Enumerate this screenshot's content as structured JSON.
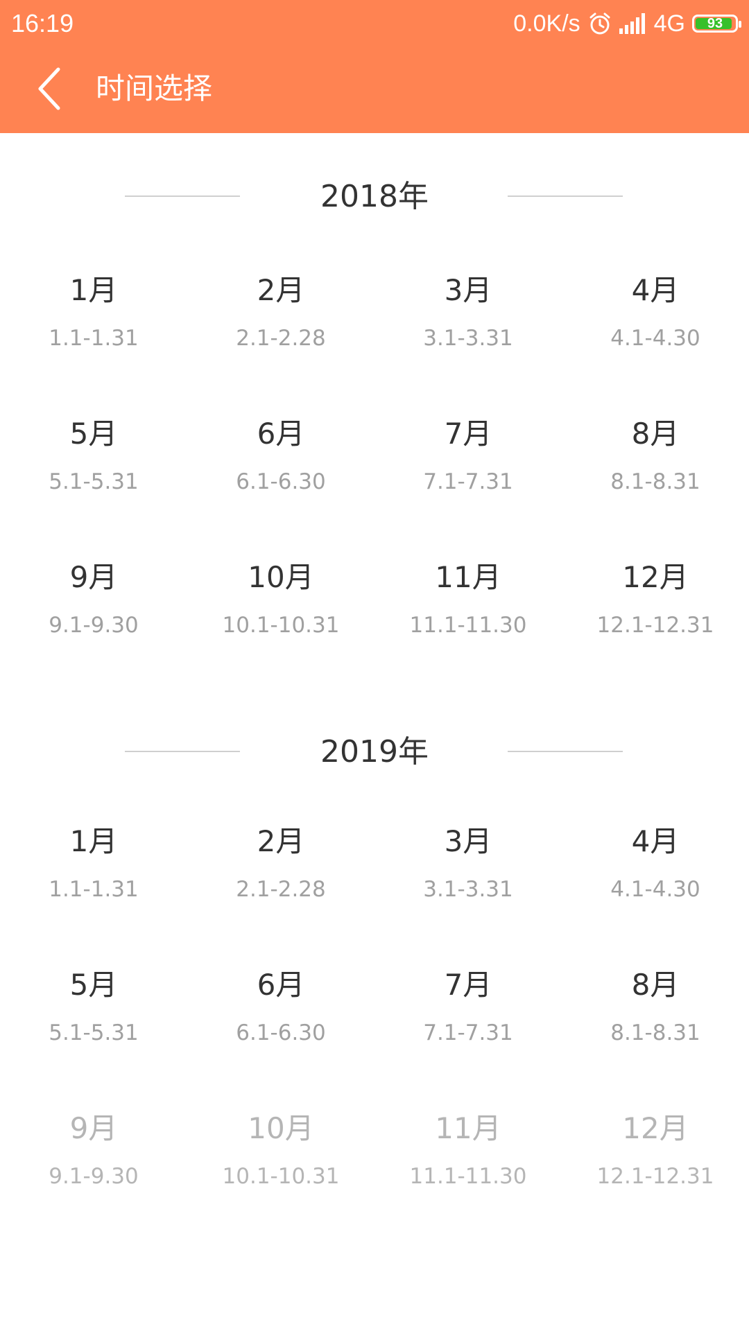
{
  "status_bar": {
    "time": "16:19",
    "net_speed": "0.0K/s",
    "alarm_icon": "alarm-clock-icon",
    "signal_icon": "signal-bars-icon",
    "network_type": "4G",
    "battery_level": "93",
    "battery_color": "#36c02a"
  },
  "header": {
    "background_color": "#ff8352",
    "back_icon": "chevron-left-icon",
    "title": "时间选择"
  },
  "years": [
    {
      "label": "2018年",
      "months": [
        {
          "name": "1月",
          "range": "1.1-1.31",
          "enabled": true
        },
        {
          "name": "2月",
          "range": "2.1-2.28",
          "enabled": true
        },
        {
          "name": "3月",
          "range": "3.1-3.31",
          "enabled": true
        },
        {
          "name": "4月",
          "range": "4.1-4.30",
          "enabled": true
        },
        {
          "name": "5月",
          "range": "5.1-5.31",
          "enabled": true
        },
        {
          "name": "6月",
          "range": "6.1-6.30",
          "enabled": true
        },
        {
          "name": "7月",
          "range": "7.1-7.31",
          "enabled": true
        },
        {
          "name": "8月",
          "range": "8.1-8.31",
          "enabled": true
        },
        {
          "name": "9月",
          "range": "9.1-9.30",
          "enabled": true
        },
        {
          "name": "10月",
          "range": "10.1-10.31",
          "enabled": true
        },
        {
          "name": "11月",
          "range": "11.1-11.30",
          "enabled": true
        },
        {
          "name": "12月",
          "range": "12.1-12.31",
          "enabled": true
        }
      ]
    },
    {
      "label": "2019年",
      "months": [
        {
          "name": "1月",
          "range": "1.1-1.31",
          "enabled": true
        },
        {
          "name": "2月",
          "range": "2.1-2.28",
          "enabled": true
        },
        {
          "name": "3月",
          "range": "3.1-3.31",
          "enabled": true
        },
        {
          "name": "4月",
          "range": "4.1-4.30",
          "enabled": true
        },
        {
          "name": "5月",
          "range": "5.1-5.31",
          "enabled": true
        },
        {
          "name": "6月",
          "range": "6.1-6.30",
          "enabled": true
        },
        {
          "name": "7月",
          "range": "7.1-7.31",
          "enabled": true
        },
        {
          "name": "8月",
          "range": "8.1-8.31",
          "enabled": true
        },
        {
          "name": "9月",
          "range": "9.1-9.30",
          "enabled": false
        },
        {
          "name": "10月",
          "range": "10.1-10.31",
          "enabled": false
        },
        {
          "name": "11月",
          "range": "11.1-11.30",
          "enabled": false
        },
        {
          "name": "12月",
          "range": "12.1-12.31",
          "enabled": false
        }
      ]
    }
  ]
}
